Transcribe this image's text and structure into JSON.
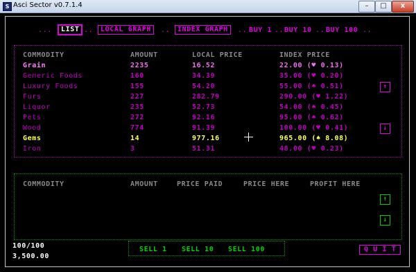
{
  "window": {
    "title": "Asci Sector v0.7.1.4",
    "icon_label": "S",
    "minimize": "–",
    "maximize": "□",
    "close": "x"
  },
  "tabs": [
    {
      "label": "LIST",
      "active": true
    },
    {
      "label": "LOCAL GRAPH",
      "active": false
    },
    {
      "label": "INDEX GRAPH",
      "active": false
    }
  ],
  "buy_buttons": [
    "BUY 1",
    "BUY 10",
    "BUY 100"
  ],
  "market": {
    "headers": [
      "COMMODITY",
      "AMOUNT",
      "LOCAL PRICE",
      "INDEX PRICE"
    ],
    "rows": [
      {
        "name": "Grain",
        "amount": "2235",
        "local": "16.52",
        "index": "22.00 (♥ 0.13)",
        "style": "selected"
      },
      {
        "name": "Generic Foods",
        "amount": "160",
        "local": "34.39",
        "index": "35.00 (♥ 0.20)",
        "style": "normal"
      },
      {
        "name": "Luxury Foods",
        "amount": "155",
        "local": "54.20",
        "index": "55.00 (♠ 0.51)",
        "style": "normal"
      },
      {
        "name": "Furs",
        "amount": "227",
        "local": "282.79",
        "index": "290.00 (♥ 1.22)",
        "style": "normal"
      },
      {
        "name": "Liquor",
        "amount": "235",
        "local": "52.73",
        "index": "54.00 (♠ 0.45)",
        "style": "normal"
      },
      {
        "name": "Pets",
        "amount": "272",
        "local": "92.16",
        "index": "95.00 (♠ 0.62)",
        "style": "normal"
      },
      {
        "name": "Wood",
        "amount": "774",
        "local": "91.39",
        "index": "100.00 (♥ 0.41)",
        "style": "normal"
      },
      {
        "name": "Gems",
        "amount": "14",
        "local": "977.16",
        "index": "965.00 (♠ 8.08)",
        "style": "highlight"
      },
      {
        "name": "Iron",
        "amount": "3",
        "local": "51.31",
        "index": "48.00 (♥ 0.23)",
        "style": "normal"
      }
    ],
    "scroll_up": "↑",
    "scroll_down": "↓"
  },
  "cargo": {
    "headers": [
      "COMMODITY",
      "AMOUNT",
      "PRICE PAID",
      "PRICE HERE",
      "PROFIT HERE"
    ],
    "scroll_up": "↑",
    "scroll_down": "↓"
  },
  "status": {
    "capacity": "100/100",
    "credits": "3,500.00"
  },
  "sell_buttons": [
    "SELL 1",
    "SELL 10",
    "SELL 100"
  ],
  "quit_label": "Q U I T",
  "colors": {
    "accent": "#e000e0",
    "green": "#00d000",
    "highlight": "#ffff60",
    "gray": "#8a8a8a"
  }
}
